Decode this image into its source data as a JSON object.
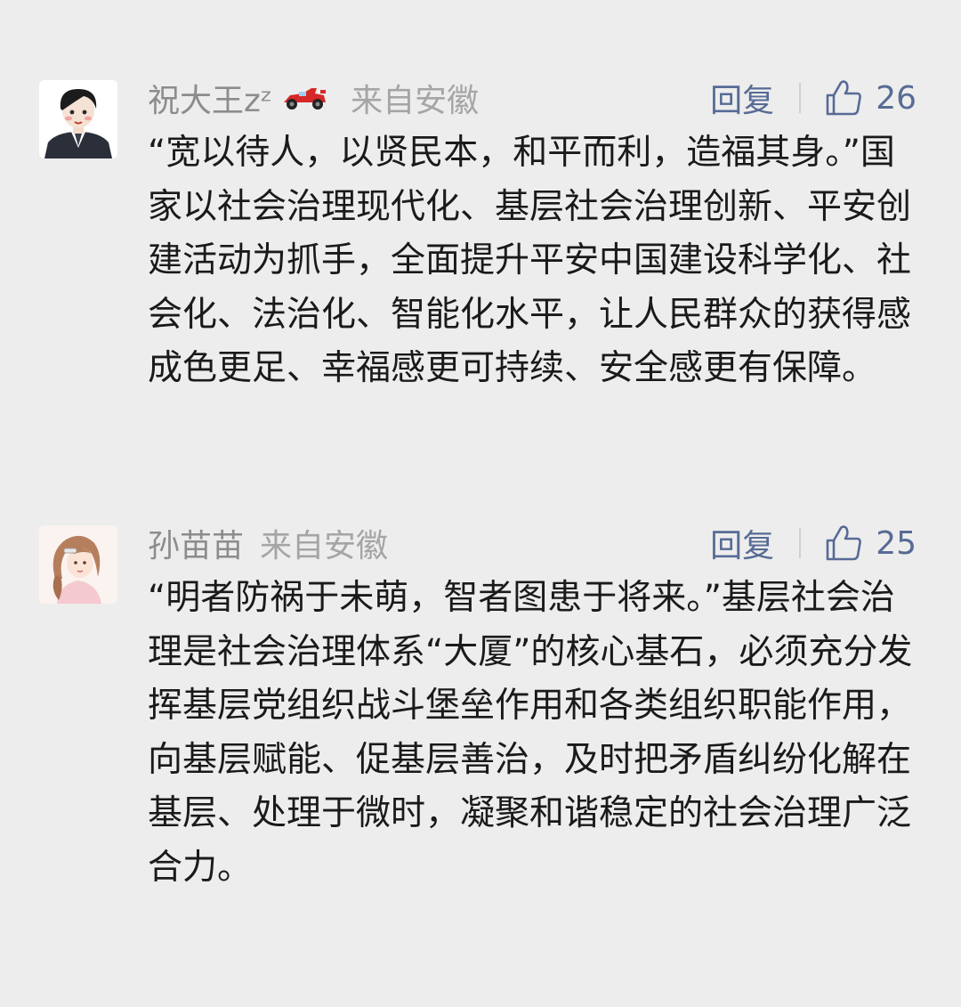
{
  "comments": [
    {
      "nickname": "祝大王zᶻ",
      "location": "来自安徽",
      "reply_label": "回复",
      "like_count": "26",
      "text": "“宽以待人，以贤民本，和平而利，造福其身。”国家以社会治理现代化、基层社会治理创新、平安创建活动为抓手，全面提升平安中国建设科学化、社会化、法治化、智能化水平，让人民群众的获得感成色更足、幸福感更可持续、安全感更有保障。"
    },
    {
      "nickname": "孙苗苗",
      "location": "来自安徽",
      "reply_label": "回复",
      "like_count": "25",
      "text": "“明者防祸于未萌，智者图患于将来。”基层社会治理是社会治理体系“大厦”的核心基石，必须充分发挥基层党组织战斗堡垒作用和各类组织职能作用，向基层赋能、促基层善治，及时把矛盾纠纷化解在基层、处理于微时，凝聚和谐稳定的社会治理广泛合力。"
    }
  ],
  "icons": {
    "thumb": "thumbs-up-outline",
    "car": "race-car-emoji"
  },
  "colors": {
    "background": "#ededed",
    "nickname": "#8c8c8c",
    "location": "#a5a5a5",
    "link": "#576b95",
    "text": "#1a1a1a"
  }
}
